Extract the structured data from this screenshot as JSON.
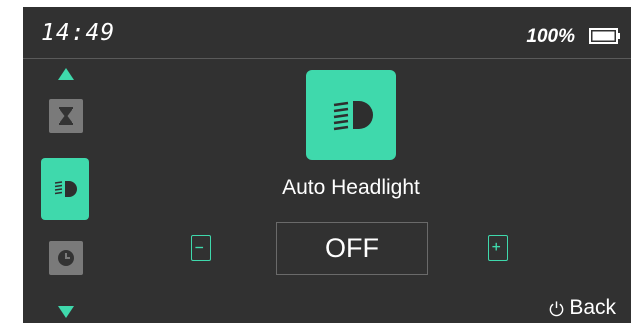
{
  "status": {
    "time": "14:49",
    "battery_text": "100%",
    "battery_level": 1.0
  },
  "sidebar": {
    "items": [
      {
        "icon": "hourglass-icon",
        "active": false
      },
      {
        "icon": "headlight-icon",
        "active": true
      },
      {
        "icon": "clock-icon",
        "active": false
      }
    ]
  },
  "feature": {
    "icon": "headlight-icon",
    "title": "Auto Headlight",
    "value": "OFF"
  },
  "controls": {
    "decrease_icon": "minus-icon",
    "increase_icon": "plus-icon"
  },
  "footer": {
    "back_label": "Back",
    "back_icon": "power-icon"
  },
  "colors": {
    "background": "#313131",
    "accent": "#3fd9ac",
    "inactive_tile": "#7a7a7a"
  }
}
